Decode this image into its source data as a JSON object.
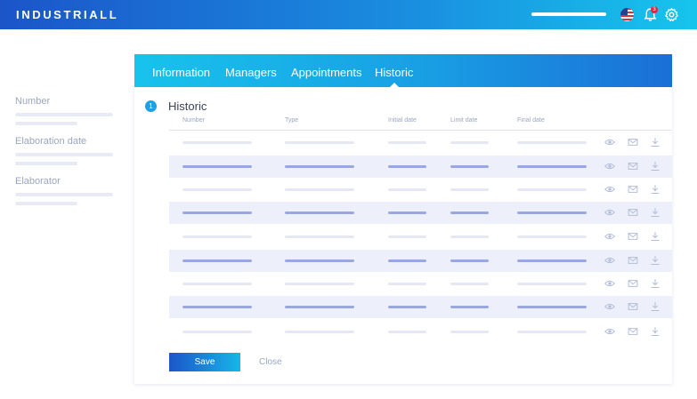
{
  "header": {
    "brand": "INDUSTRIALL",
    "notification_count": "3",
    "icons": [
      "search-bar",
      "us-flag-icon",
      "bell-icon",
      "gear-icon"
    ]
  },
  "sidebar": {
    "fields": [
      {
        "label": "Number"
      },
      {
        "label": "Elaboration date"
      },
      {
        "label": "Elaborator"
      }
    ]
  },
  "tabs": [
    {
      "label": "Information"
    },
    {
      "label": "Managers"
    },
    {
      "label": "Appointments"
    },
    {
      "label": "Historic",
      "active": true
    }
  ],
  "section": {
    "step": "1",
    "title": "Historic"
  },
  "table": {
    "columns": [
      "Number",
      "Type",
      "Initial date",
      "Limit date",
      "Final date"
    ],
    "row_count": 9,
    "row_actions": [
      "eye-icon",
      "mail-icon",
      "download-icon"
    ]
  },
  "footer": {
    "save_label": "Save",
    "close_label": "Close"
  },
  "colors": {
    "primary": "#1b56c8",
    "accent": "#17c3ec",
    "muted_text": "#9aa6c2",
    "row_stripe": "#edf0fa",
    "notification": "#e2253a"
  }
}
